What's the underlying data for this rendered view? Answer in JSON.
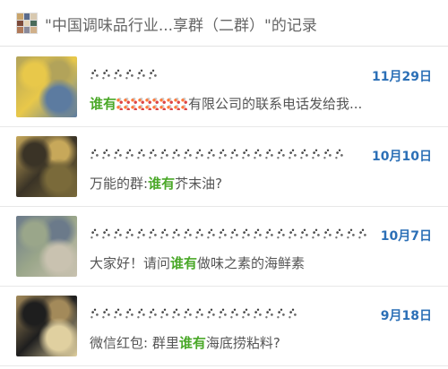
{
  "header": {
    "title": "\"中国调味品行业...享群（二群）\"的记录",
    "group_avatar_colors": [
      "#c9a46b",
      "#5a6b8c",
      "#d8c9b0",
      "#7c4a3a",
      "#e5d4b8",
      "#4a6b5a",
      "#b07a5a",
      "#8a8a9a",
      "#d0b08a"
    ]
  },
  "records": [
    {
      "date": "11月29日",
      "preview_parts": [
        {
          "text": "谁有",
          "highlight": true
        },
        {
          "text": "",
          "mosaic": true
        },
        {
          "text": "有限公司的联系电话发给我...",
          "highlight": false
        }
      ],
      "avatar_colors": [
        "#e8c84a",
        "#b2a35a",
        "#5c7ba0"
      ]
    },
    {
      "date": "10月10日",
      "preview_parts": [
        {
          "text": "万能的群:",
          "highlight": false
        },
        {
          "text": "谁有",
          "highlight": true
        },
        {
          "text": "芥末油?",
          "highlight": false
        }
      ],
      "avatar_colors": [
        "#3a3326",
        "#c7a85a",
        "#7a6a3a"
      ]
    },
    {
      "date": "10月7日",
      "preview_parts": [
        {
          "text": "大家好！请问",
          "highlight": false
        },
        {
          "text": "谁有",
          "highlight": true
        },
        {
          "text": "做味之素的海鲜素",
          "highlight": false
        }
      ],
      "avatar_colors": [
        "#9aa68a",
        "#6b7a8a",
        "#c9c2b0"
      ]
    },
    {
      "date": "9月18日",
      "preview_parts": [
        {
          "text": "微信红包: 群里",
          "highlight": false
        },
        {
          "text": "谁有",
          "highlight": true
        },
        {
          "text": "海底捞粘料?",
          "highlight": false
        }
      ],
      "avatar_colors": [
        "#1e1e1e",
        "#a38a5a",
        "#e0d0a0"
      ]
    }
  ]
}
